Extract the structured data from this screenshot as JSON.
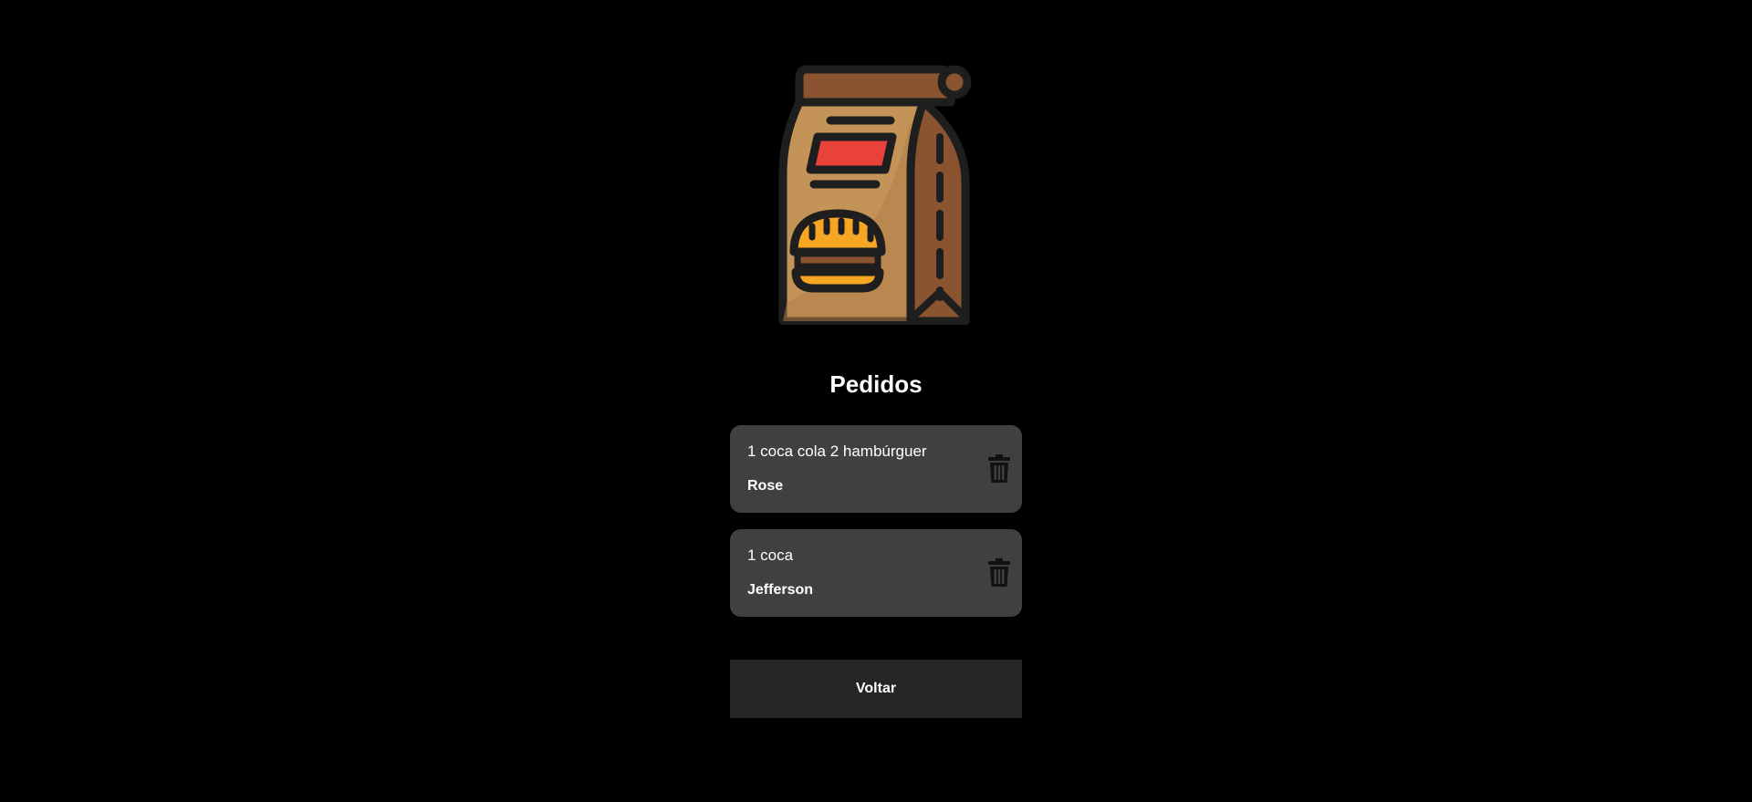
{
  "header": {
    "logo_icon": "food-bag-burger-icon",
    "title": "Pedidos"
  },
  "orders": [
    {
      "description": "1 coca cola 2 hambúrguer",
      "client": "Rose",
      "delete_icon": "trash-icon"
    },
    {
      "description": "1 coca",
      "client": "Jefferson",
      "delete_icon": "trash-icon"
    }
  ],
  "actions": {
    "back_label": "Voltar"
  },
  "colors": {
    "background": "#000000",
    "card": "#404040",
    "button": "#262626",
    "text": "#ffffff",
    "bag_light": "#c39358",
    "bag_dark": "#8a5431",
    "burger": "#f6a623",
    "label_red": "#e8423a",
    "outline": "#1e1e1e"
  }
}
